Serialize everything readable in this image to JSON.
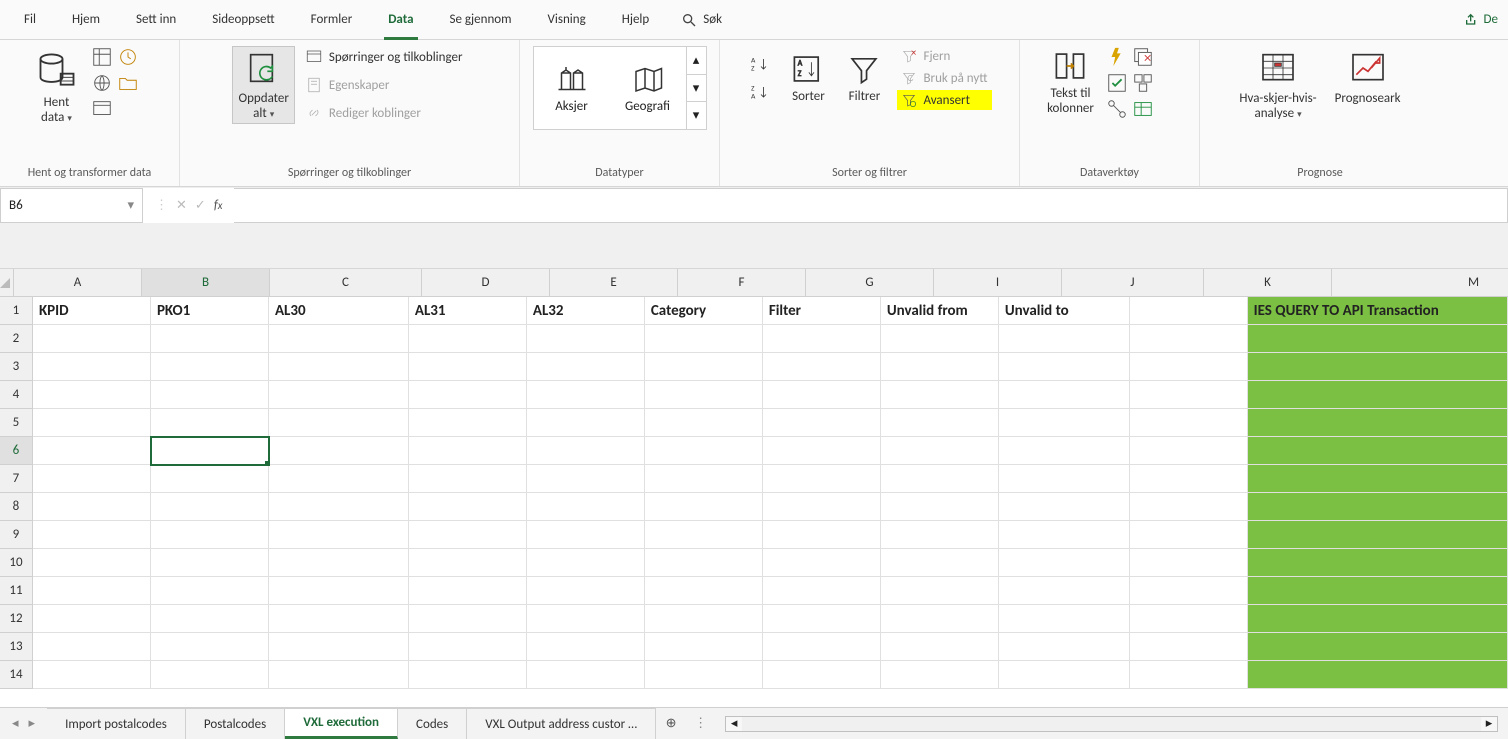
{
  "ribbon_tabs": {
    "fil": "Fil",
    "hjem": "Hjem",
    "settinn": "Sett inn",
    "sideoppsett": "Sideoppsett",
    "formler": "Formler",
    "data": "Data",
    "segjennom": "Se gjennom",
    "visning": "Visning",
    "hjelp": "Hjelp",
    "sok": "Søk",
    "de": "De"
  },
  "ribbon": {
    "group1": {
      "hent_data": "Hent\ndata",
      "label": "Hent og transformer data"
    },
    "group2": {
      "oppdater": "Oppdater\nalt",
      "sporringer": "Spørringer og tilkoblinger",
      "egenskaper": "Egenskaper",
      "rediger": "Rediger koblinger",
      "label": "Spørringer og tilkoblinger"
    },
    "group3": {
      "aksjer": "Aksjer",
      "geografi": "Geografi",
      "label": "Datatyper"
    },
    "group4": {
      "sorter": "Sorter",
      "filtrer": "Filtrer",
      "fjern": "Fjern",
      "bruk": "Bruk på nytt",
      "avansert": "Avansert",
      "label": "Sorter og filtrer"
    },
    "group5": {
      "tekst": "Tekst til\nkolonner",
      "label": "Dataverktøy"
    },
    "group6": {
      "hva": "Hva-skjer-hvis-\nanalyse",
      "prognoseark": "Prognoseark",
      "label": "Prognose"
    }
  },
  "name_box": "B6",
  "formula": "",
  "columns": [
    "A",
    "B",
    "C",
    "D",
    "E",
    "F",
    "G",
    "I",
    "J",
    "K",
    "M"
  ],
  "headers": {
    "A": "KPID",
    "B": "PKO1",
    "C": "AL30",
    "D": "AL31",
    "E": "AL32",
    "F": "Category",
    "G": "Filter",
    "I": "Unvalid from",
    "J": "Unvalid to",
    "K": "",
    "M": "IES QUERY TO API Transaction"
  },
  "rows": [
    1,
    2,
    3,
    4,
    5,
    6,
    7,
    8,
    9,
    10,
    11,
    12,
    13,
    14
  ],
  "sheet_tabs": {
    "t1": "Import postalcodes",
    "t2": "Postalcodes",
    "t3": "VXL execution",
    "t4": "Codes",
    "t5": "VXL Output address custor …"
  }
}
